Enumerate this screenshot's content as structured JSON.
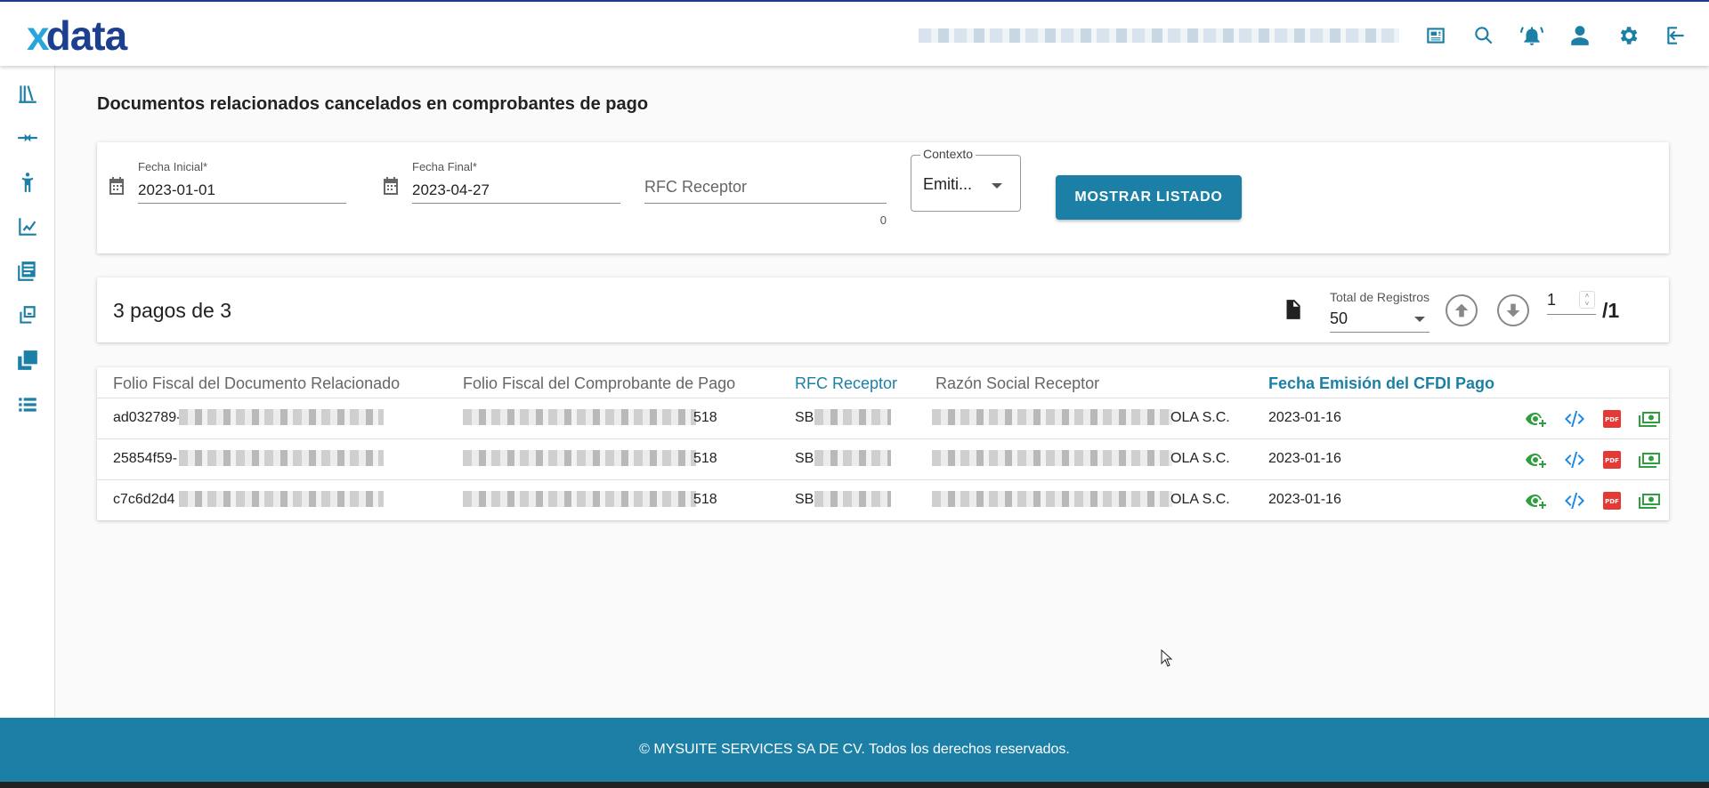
{
  "brand": {
    "logo_x": "x",
    "logo_data": "data"
  },
  "header": {
    "icons": [
      "news-icon",
      "search-icon",
      "alarm-bell-icon",
      "user-icon",
      "settings-icon",
      "logout-icon"
    ]
  },
  "sidebar": {
    "icons": [
      "library-icon",
      "compare-arrows-icon",
      "person-icon",
      "chart-line-icon",
      "documents-icon",
      "copy-icon",
      "layers-icon",
      "list-icon"
    ]
  },
  "page": {
    "title": "Documentos relacionados cancelados en comprobantes de pago"
  },
  "filters": {
    "fecha_inicial": {
      "label": "Fecha Inicial*",
      "value": "2023-01-01"
    },
    "fecha_final": {
      "label": "Fecha Final*",
      "value": "2023-04-27"
    },
    "rfc": {
      "placeholder": "RFC Receptor",
      "count": "0"
    },
    "contexto": {
      "label": "Contexto",
      "value": "Emiti..."
    },
    "submit_label": "MOSTRAR LISTADO"
  },
  "results": {
    "summary": "3 pagos de 3",
    "page_size_label": "Total de Registros",
    "page_size": "50",
    "page": "1",
    "page_total": "/1"
  },
  "table": {
    "columns": [
      "Folio Fiscal del Documento Relacionado",
      "Folio Fiscal del Comprobante de Pago",
      "RFC Receptor",
      "Razón Social Receptor",
      "Fecha Emisión del CFDI Pago"
    ],
    "rows": [
      {
        "folio_doc": "ad032789-",
        "folio_pago_tail": "518",
        "rfc_prefix": "SBI",
        "razon_tail": "OLA S.C.",
        "fecha": "2023-01-16"
      },
      {
        "folio_doc": "25854f59-",
        "folio_pago_tail": "518",
        "rfc_prefix": "SBI",
        "razon_tail": "OLA S.C.",
        "fecha": "2023-01-16"
      },
      {
        "folio_doc": "c7c6d2d4",
        "folio_pago_tail": "518",
        "rfc_prefix": "SBI",
        "razon_tail": "OLA S.C.",
        "fecha": "2023-01-16"
      }
    ],
    "row_action_icons": [
      "view-add-icon",
      "code-icon",
      "pdf-icon",
      "cash-icon"
    ],
    "colors": {
      "view": "#2e9e3e",
      "code": "#1e88e5",
      "pdf": "#e53935",
      "cash": "#2e9e3e"
    }
  },
  "footer": {
    "text": "© MYSUITE SERVICES SA DE CV. Todos los derechos reservados."
  }
}
